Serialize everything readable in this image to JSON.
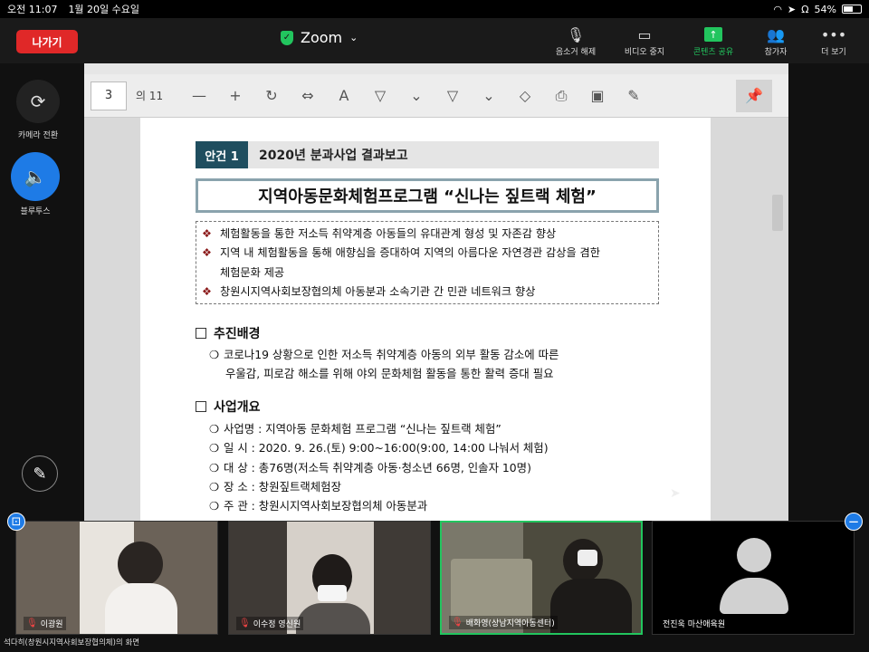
{
  "statusbar": {
    "time": "오전 11:07",
    "date": "1월 20일 수요일",
    "battery": "54%"
  },
  "topbar": {
    "leave": "나가기",
    "title": "Zoom",
    "buttons": [
      {
        "label": "음소거 해제",
        "icon": "mic-off-icon"
      },
      {
        "label": "비디오 중지",
        "icon": "video-icon"
      },
      {
        "label": "콘텐츠 공유",
        "icon": "share-icon"
      },
      {
        "label": "참가자",
        "icon": "people-icon"
      },
      {
        "label": "더 보기",
        "icon": "more-icon"
      }
    ]
  },
  "sidebar": {
    "camera": "카메라 전환",
    "bluetooth": "블루투스"
  },
  "viewer": {
    "page": "3",
    "of": "의 11"
  },
  "doc": {
    "agenda_tag": "안건 1",
    "agenda_title": "2020년 분과사업 결과보고",
    "main_title": "지역아동문화체험프로그램 “신나는 짚트랙 체험”",
    "goals": [
      "체험활동을 통한 저소득 취약계층 아동들의 유대관계 형성 및 자존감 향상",
      "지역 내 체험활동을 통해 애향심을 증대하여 지역의 아름다운 자연경관 감상을 겸한",
      "체험문화 제공",
      "창원시지역사회보장협의체 아동분과 소속기관 간 민관 네트워크 향상"
    ],
    "section1": "추진배경",
    "section1_items": [
      "코로나19 상황으로 인한 저소득 취약계층 아동의 외부 활동 감소에 따른",
      "우울감, 피로감 해소를 위해 야외 문화체험 활동을 통한 활력 증대 필요"
    ],
    "section2": "사업개요",
    "section2_items": [
      "사업명 : 지역아동 문화체험 프로그램 “신나는 짚트랙 체험”",
      "일   시 : 2020. 9. 26.(토) 9:00~16:00(9:00, 14:00 나눠서 체험)",
      "대   상 : 총76명(저소득 취약계층 아동·청소년 66명, 인솔자 10명)",
      "장   소 : 창원짚트랙체험장",
      "주   관 : 창원시지역사회보장협의체 아동분과"
    ]
  },
  "participants": [
    {
      "name": "이광원"
    },
    {
      "name": "이수정 영신원"
    },
    {
      "name": "배화영(상남지역아동센터)"
    },
    {
      "name": "전진욱 마산애육원"
    }
  ],
  "screen_label": "석다히(창원시지역사회보장협의체)의 화면"
}
